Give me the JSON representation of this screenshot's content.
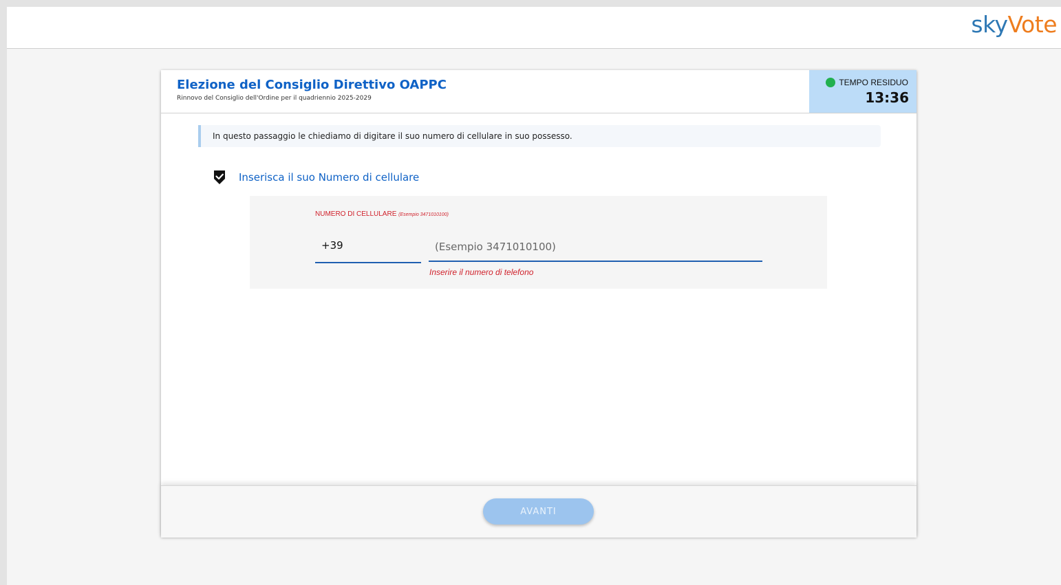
{
  "brand": {
    "logo_part1": "sky",
    "logo_part2": "Vote",
    "color_sky": "#2e78b4",
    "color_vote": "#ee7d1e"
  },
  "header": {
    "title": "Elezione del Consiglio Direttivo OAPPC",
    "subtitle": "Rinnovo del Consiglio dell'Ordine per il quadriennio 2025-2029"
  },
  "timer": {
    "label": "TEMPO RESIDUO",
    "value": "13:36",
    "status_color": "#22b04e"
  },
  "info": {
    "text": "In questo passaggio le chiediamo di digitare il suo numero di cellulare in suo possesso."
  },
  "section": {
    "icon": "shield-check-icon",
    "title": "Inserisca il suo Numero di cellulare"
  },
  "form": {
    "label": "NUMERO DI CELLULARE",
    "label_hint": "(Esempio 3471010100)",
    "prefix_value": "+39",
    "phone_value": "",
    "phone_placeholder": "(Esempio 3471010100)",
    "error": "Inserire il numero di telefono"
  },
  "footer": {
    "next_label": "AVANTI",
    "next_enabled": false
  }
}
